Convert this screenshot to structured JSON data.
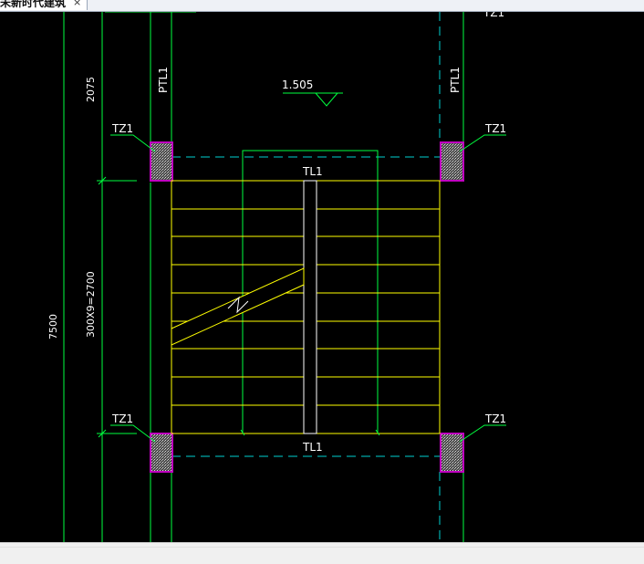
{
  "tab": {
    "title": "未新时代建筑",
    "close_glyph": "×"
  },
  "drawing": {
    "dim_upper": "2075",
    "dim_stair": "300X9=2700",
    "dim_total": "7500",
    "elevation": "1.505",
    "column_label": "TZ1",
    "beam_label": "TL1",
    "platform_beam_label": "PTL1",
    "colors": {
      "background": "#000000",
      "green": "#00ff3f",
      "cyan": "#00d0d0",
      "yellow": "#ffff00",
      "magenta": "#c000c0",
      "white": "#ffffff"
    }
  }
}
